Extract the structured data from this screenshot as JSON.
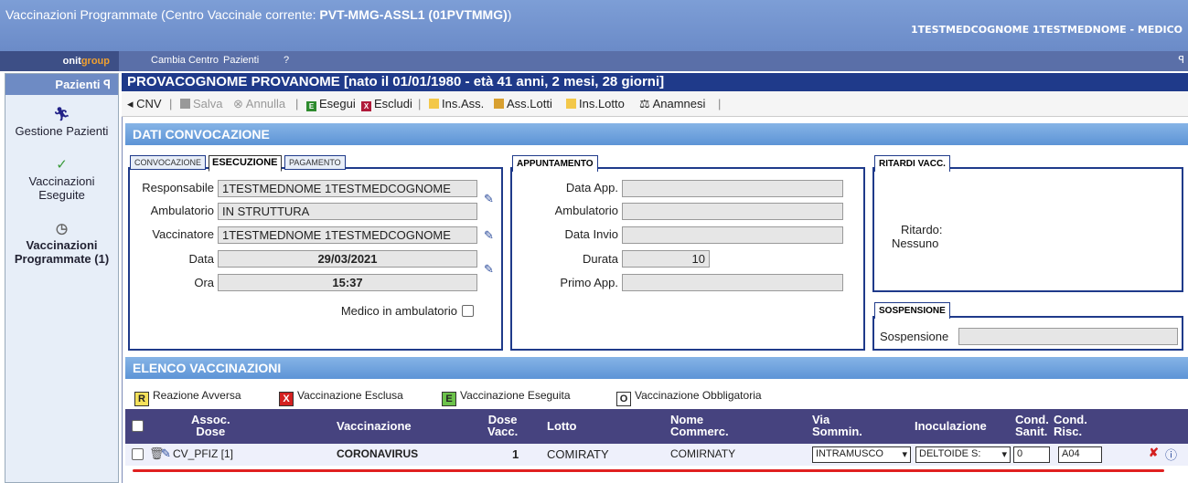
{
  "window": {
    "title_prefix": "Vaccinazioni Programmate (Centro Vaccinale corrente: ",
    "title_center": "PVT-MMG-ASSL1 (01PVTMMG)",
    "title_suffix": ")",
    "user": "1TESTMEDCOGNOME 1TESTMEDNOME - MEDICO"
  },
  "menu": {
    "logo_a": "onit",
    "logo_b": "group",
    "items": [
      "Cambia Centro",
      "Pazienti",
      "?"
    ],
    "pin": "ꟼ"
  },
  "sidebar": {
    "header": "Pazienti",
    "pin": "ꟼ",
    "items": [
      {
        "label": "Gestione Pazienti",
        "icon": "runner-icon"
      },
      {
        "label": "Vaccinazioni Eseguite",
        "icon": "syringe-check-icon"
      },
      {
        "label": "Vaccinazioni Programmate (1)",
        "icon": "syringe-clock-icon"
      }
    ]
  },
  "patient": {
    "header": "PROVACOGNOME PROVANOME [nato il 01/01/1980 - età 41 anni, 2 mesi, 28 giorni]"
  },
  "toolbar": {
    "back": "CNV",
    "save": "Salva",
    "cancel": "Annulla",
    "execute": "Esegui",
    "exclude": "Escludi",
    "ins_ass": "Ins.Ass.",
    "ass_lotti": "Ass.Lotti",
    "ins_lotto": "Ins.Lotto",
    "anamnesi": "Anamnesi"
  },
  "convocazione": {
    "section_title": "DATI CONVOCAZIONE",
    "tabs": [
      "CONVOCAZIONE",
      "ESECUZIONE",
      "PAGAMENTO"
    ],
    "fields": {
      "responsabile_label": "Responsabile",
      "responsabile": "1TESTMEDNOME 1TESTMEDCOGNOME",
      "ambulatorio_label": "Ambulatorio",
      "ambulatorio": "IN STRUTTURA",
      "vaccinatore_label": "Vaccinatore",
      "vaccinatore": "1TESTMEDNOME 1TESTMEDCOGNOME",
      "data_label": "Data",
      "data": "29/03/2021",
      "ora_label": "Ora",
      "ora": "15:37",
      "medico_label": "Medico in ambulatorio"
    }
  },
  "appuntamento": {
    "tab": "APPUNTAMENTO",
    "data_app_label": "Data App.",
    "data_app": "",
    "ambulatorio_label": "Ambulatorio",
    "ambulatorio": "",
    "data_invio_label": "Data Invio",
    "data_invio": "",
    "durata_label": "Durata",
    "durata": "10",
    "primo_app_label": "Primo App.",
    "primo_app": ""
  },
  "ritardi": {
    "tab": "RITARDI VACC.",
    "label": "Ritardo:",
    "value": "Nessuno"
  },
  "sospensione": {
    "tab": "SOSPENSIONE",
    "label": "Sospensione",
    "value": ""
  },
  "elenco": {
    "section_title": "ELENCO VACCINAZIONI",
    "legend": [
      {
        "key": "R",
        "label": "Reazione Avversa",
        "color": "#f5e15a"
      },
      {
        "key": "X",
        "label": "Vaccinazione Esclusa",
        "color": "#d42020"
      },
      {
        "key": "E",
        "label": "Vaccinazione Eseguita",
        "color": "#6cc24a"
      },
      {
        "key": "O",
        "label": "Vaccinazione Obbligatoria",
        "color": "#ffffff"
      }
    ],
    "columns": {
      "assoc": "Assoc.",
      "dose": "Dose",
      "vaccinazione": "Vaccinazione",
      "dose_vacc_a": "Dose",
      "dose_vacc_b": "Vacc.",
      "lotto": "Lotto",
      "nome_a": "Nome",
      "nome_b": "Commerc.",
      "via_a": "Via",
      "via_b": "Sommin.",
      "inoculazione": "Inoculazione",
      "cond_a": "Cond.",
      "sanit": "Sanit.",
      "cond_b": "Cond.",
      "risc": "Risc."
    },
    "rows": [
      {
        "assoc": "CV_PFIZ [1]",
        "vaccinazione": "CORONAVIRUS",
        "dose": "1",
        "lotto": "COMIRATY",
        "nome": "COMIRNATY",
        "via": "INTRAMUSCO",
        "inoculazione": "DELTOIDE S:",
        "cond_sanit": "0",
        "cond_risc": "A04"
      }
    ]
  }
}
